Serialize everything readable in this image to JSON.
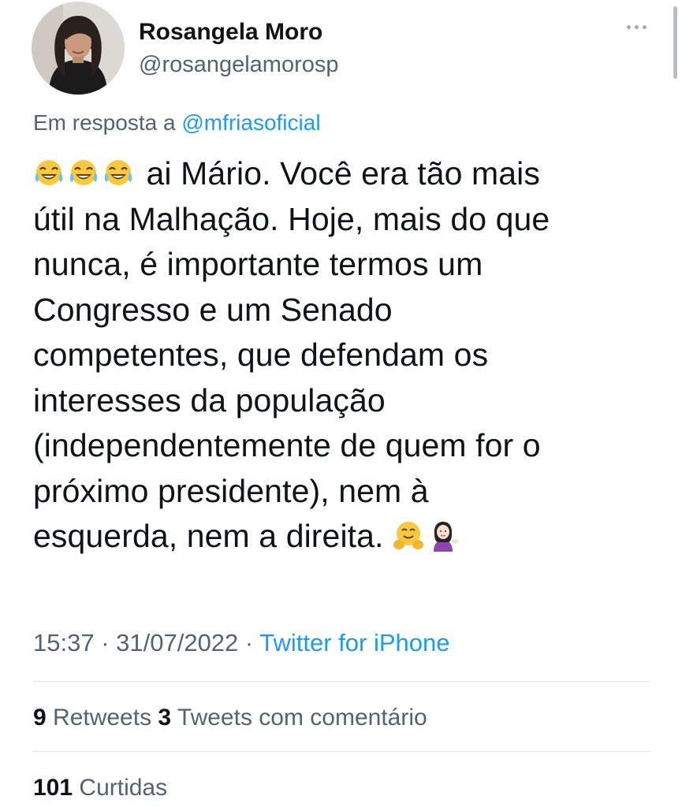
{
  "author": {
    "display_name": "Rosangela Moro",
    "handle": "@rosangelamorosp"
  },
  "reply_context": {
    "prefix": "Em resposta a ",
    "mention": "@mfriasoficial"
  },
  "tweet": {
    "lines": [
      "ai Mário. Você era tão mais",
      "útil na Malhação. Hoje, mais do que",
      "nunca, é importante termos um",
      "Congresso e um Senado",
      "competentes, que defendam os",
      "interesses da população",
      "(independentemente de quem for o",
      "próximo presidente), nem à",
      "esquerda, nem a direita."
    ],
    "leading_emoji": [
      "joy-emoji",
      "joy-emoji",
      "joy-emoji"
    ],
    "trailing_emoji": [
      "hugging-emoji",
      "tipping-hand-woman-emoji"
    ]
  },
  "meta": {
    "time": "15:37",
    "separator": " · ",
    "date": "31/07/2022",
    "source": "Twitter for iPhone"
  },
  "stats": {
    "retweets_count": "9",
    "retweets_label": " Retweets",
    "quotes_count": "3",
    "quotes_label": " Tweets com comentário",
    "likes_count": "101",
    "likes_label": " Curtidas"
  },
  "colors": {
    "text": "#0f1419",
    "secondary": "#536471",
    "link": "#1d9bf0",
    "divider": "#dfe3e6"
  }
}
